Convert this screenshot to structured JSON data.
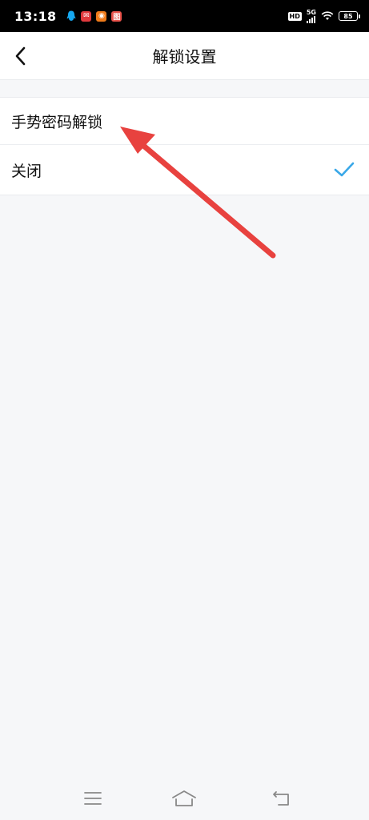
{
  "status_bar": {
    "time": "13:18",
    "notification_icons": [
      "qq-icon",
      "app-icon-red",
      "weibo-icon",
      "app-icon-red-2"
    ],
    "hd_label": "HD",
    "network_label": "5G",
    "battery_level": "85"
  },
  "header": {
    "title": "解锁设置",
    "back_icon": "chevron-left-icon"
  },
  "options": [
    {
      "label": "手势密码解锁",
      "selected": false
    },
    {
      "label": "关闭",
      "selected": true
    }
  ],
  "nav_bar": {
    "icons": [
      "menu-icon",
      "home-icon",
      "back-icon"
    ]
  },
  "colors": {
    "accent": "#3aa8e8",
    "annotation": "#e8423f",
    "background": "#f6f7f9"
  }
}
